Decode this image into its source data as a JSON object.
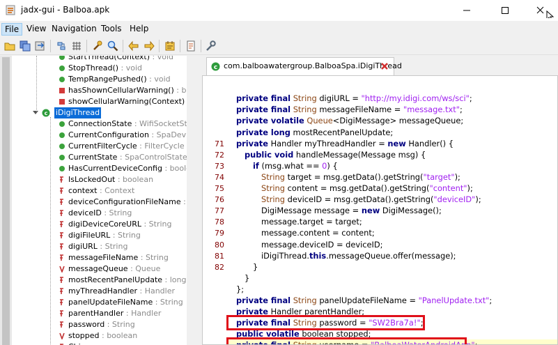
{
  "window": {
    "title": "jadx-gui - Balboa.apk"
  },
  "menu": [
    "File",
    "View",
    "Navigation",
    "Tools",
    "Help"
  ],
  "toolbar_icons": [
    "open-file-icon",
    "save-all-icon",
    "export-icon",
    "sync-icon",
    "flatten-icon",
    "decompile-icon",
    "search-icon",
    "back-icon",
    "forward-icon",
    "log-icon",
    "deobfuscation-icon",
    "preferences-icon"
  ],
  "tree": {
    "methods": [
      {
        "name": "StartThread(Context)",
        "type": ": void"
      },
      {
        "name": "StopThread()",
        "type": ": void"
      },
      {
        "name": "TempRangePushed()",
        "type": ": void"
      },
      {
        "name": "hasShownCellularWarning()",
        "type": ": boole"
      },
      {
        "name": "showCellularWarning(Context)",
        "type": ": vo"
      }
    ],
    "class_name": "iDigiThread",
    "members": [
      {
        "name": "ConnectionState",
        "type": ": WifiSocketState",
        "kind": "inner"
      },
      {
        "name": "CurrentConfiguration",
        "type": ": SpaDeviceC",
        "kind": "inner"
      },
      {
        "name": "CurrentFilterCycle",
        "type": ": FilterCycle",
        "kind": "inner"
      },
      {
        "name": "CurrentState",
        "type": ": SpaControlState",
        "kind": "inner"
      },
      {
        "name": "HasCurrentDeviceConfig",
        "type": ": boolean",
        "kind": "inner"
      },
      {
        "name": "IsLockedOut",
        "type": ": boolean",
        "kind": "field"
      },
      {
        "name": "context",
        "type": ": Context",
        "kind": "field"
      },
      {
        "name": "deviceConfigurationFileName",
        "type": ": Strir",
        "kind": "field"
      },
      {
        "name": "deviceID",
        "type": ": String",
        "kind": "field"
      },
      {
        "name": "digiDeviceCoreURL",
        "type": ": String",
        "kind": "field"
      },
      {
        "name": "digiFileURL",
        "type": ": String",
        "kind": "field"
      },
      {
        "name": "digiURL",
        "type": ": String",
        "kind": "field"
      },
      {
        "name": "messageFileName",
        "type": ": String",
        "kind": "field"
      },
      {
        "name": "messageQueue",
        "type": ": Queue",
        "kind": "vfield"
      },
      {
        "name": "mostRecentPanelUpdate",
        "type": ": long",
        "kind": "field"
      },
      {
        "name": "myThreadHandler",
        "type": ": Handler",
        "kind": "field"
      },
      {
        "name": "panelUpdateFileName",
        "type": ": String",
        "kind": "field"
      },
      {
        "name": "parentHandler",
        "type": ": Handler",
        "kind": "field"
      },
      {
        "name": "password",
        "type": ": String",
        "kind": "field"
      },
      {
        "name": "stopped",
        "type": ": boolean",
        "kind": "vfield"
      },
      {
        "name": "Chi",
        "type": "",
        "kind": "field"
      }
    ]
  },
  "editor": {
    "tab_label": "com.balboawatergroup.BalboaSpa.iDigiThread",
    "line_numbers": [
      "71",
      "72",
      "73",
      "74",
      "75",
      "76",
      "77",
      "78",
      "79",
      "80",
      "81",
      "82"
    ],
    "code": {
      "l0_text": "private final String digiURL = \"http://my.idigi.com/ws/sci\";",
      "l1": {
        "kw": "private final",
        "ty": "String",
        "a": " digiURL = ",
        "s": "\"http://my.idigi.com/ws/sci\"",
        "b": ";"
      },
      "l2": {
        "kw": "private final",
        "ty": "String",
        "a": " messageFileName = ",
        "s": "\"message.txt\"",
        "b": ";"
      },
      "l3": {
        "kw": "private volatile",
        "ty": "Queue",
        "a": "<DigiMessage> messageQueue;"
      },
      "l4": {
        "kw": "private long",
        "a": " mostRecentPanelUpdate;"
      },
      "l5": {
        "kw": "private",
        "a": " Handler myThreadHandler = ",
        "kw2": "new",
        "b": " Handler() {"
      },
      "l6": {
        "kw": "public void",
        "a": " handleMessage(Message msg) {"
      },
      "l7": {
        "kw": "if",
        "a": " (msg.what == ",
        "n": "0",
        "b": ") {"
      },
      "l8": {
        "ty": "String",
        "a": " target = msg.getData().getString(",
        "s": "\"target\"",
        "b": ");"
      },
      "l9": {
        "ty": "String",
        "a": " content = msg.getData().getString(",
        "s": "\"content\"",
        "b": ");"
      },
      "l10": {
        "ty": "String",
        "a": " deviceID = msg.getData().getString(",
        "s": "\"deviceID\"",
        "b": ");"
      },
      "l11": {
        "a": "DigiMessage message = ",
        "kw": "new",
        "b": " DigiMessage();"
      },
      "l12": {
        "a": "message.target = target;"
      },
      "l13": {
        "a": "message.content = content;"
      },
      "l14": {
        "a": "message.deviceID = deviceID;"
      },
      "l15": {
        "a": "iDigiThread.",
        "kw": "this",
        "b": ".messageQueue.offer(message);"
      },
      "l16": {
        "a": "}"
      },
      "l17": {
        "a": "}"
      },
      "l18": {
        "a": "};"
      },
      "l19": {
        "kw": "private final",
        "ty": "String",
        "a": " panelUpdateFileName = ",
        "s": "\"PanelUpdate.txt\"",
        "b": ";"
      },
      "l20": {
        "kw": "private",
        "a": " Handler parentHandler;"
      },
      "l21": {
        "kw": "private final",
        "ty": "String",
        "a": " password = ",
        "s": "\"SW2Bra7a!\"",
        "b": ";"
      },
      "l22": {
        "kw": "public volatile",
        "a": " boolean stopped;"
      },
      "l23": {
        "kw": "private final",
        "ty": "String",
        "a": " username = ",
        "s": "\"BalboaWaterAndroidApp\"",
        "b": ";"
      }
    }
  }
}
